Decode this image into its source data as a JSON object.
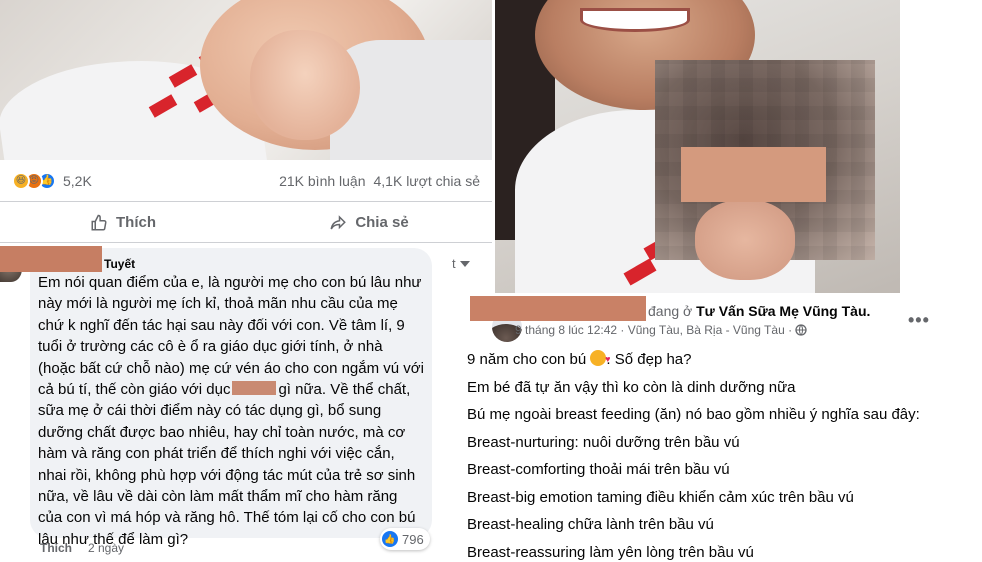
{
  "left_post": {
    "reactions": {
      "icons": [
        "haha-icon",
        "angry-icon",
        "like-icon"
      ],
      "count": "5,2K"
    },
    "comments_count": "21K bình luận",
    "shares_count": "4,1K lượt chia sẻ",
    "actions": {
      "like_label": "Thích",
      "share_label": "Chia sẻ"
    }
  },
  "comment": {
    "name_suffix": "Tuyết",
    "menu_fragment": "t",
    "text_part1": "Em nói quan điểm của e, là người mẹ cho con bú lâu như\nnày mới là người mẹ ích kỉ, thoả mãn nhu cầu của mẹ\nchứ k nghĩ đến tác hại sau này đối với con. Về tâm lí, 9\ntuổi ở trường các cô è ổ ra giáo dục giới tính, ở nhà\n(hoặc bất cứ chỗ nào) mẹ cứ vén áo cho con ngắm vú với\ncả bú tí, thế còn giáo với dục",
    "text_part2": "gì nữa. Về thể chất,\nsữa mẹ ở cái thời điểm này có tác dụng gì, bổ sung\ndưỡng chất được bao nhiêu, hay chỉ toàn nước, mà cơ\nhàm và răng con phát triển để thích nghi với việc cắn,\nnhai rồi, không phù hợp với động tác mút của trẻ sơ sinh\nnữa, về lâu về dài còn làm mất thẩm mĩ cho hàm răng\ncủa con vì má hóp và răng hô. Thế tóm lại cố cho con bú\nlâu như thế để làm gì?",
    "like_count": "796",
    "like_action": "Thích",
    "time": "2 ngày"
  },
  "right_post": {
    "location_prefix": "đang ở",
    "page_name": "Tư Vấn Sữa Mẹ Vũng Tàu.",
    "meta": "9 tháng 8 lúc 12:42 · Vũng Tàu, Bà Rịa - Vũng Tàu ·",
    "more_label": "•••",
    "line1_before": "9 năm cho con bú",
    "line1_after": ". Số đẹp ha?",
    "lines": [
      "Em bé đã tự ăn vậy thì ko còn là dinh dưỡng nữa",
      "Bú mẹ ngoài breast feeding (ăn) nó bao gồm nhiều ý nghĩa sau đây:",
      "Breast-nurturing: nuôi dưỡng trên bầu vú",
      "Breast-comforting thoải mái trên bầu vú",
      "Breast-big emotion taming điều khiển cảm xúc trên bầu vú",
      "Breast-healing chữa lành trên bầu vú",
      "Breast-reassuring làm yên lòng trên bầu vú"
    ]
  }
}
